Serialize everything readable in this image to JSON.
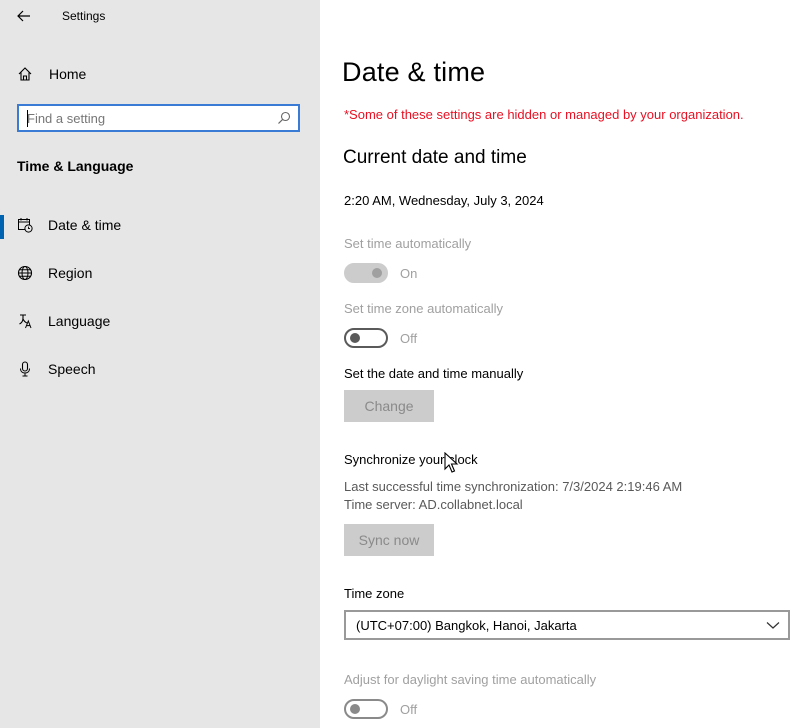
{
  "window": {
    "title": "Settings"
  },
  "nav": {
    "home_label": "Home",
    "search_placeholder": "Find a setting",
    "section_title": "Time & Language",
    "items": [
      {
        "label": "Date & time",
        "icon": "calendar-clock-icon",
        "selected": true
      },
      {
        "label": "Region",
        "icon": "globe-icon",
        "selected": false
      },
      {
        "label": "Language",
        "icon": "language-icon",
        "selected": false
      },
      {
        "label": "Speech",
        "icon": "microphone-icon",
        "selected": false
      }
    ]
  },
  "page": {
    "title": "Date & time",
    "org_note": "*Some of these settings are hidden or managed by your organization.",
    "current_heading": "Current date and time",
    "current_datetime": "2:20 AM, Wednesday, July 3, 2024",
    "set_time_auto": {
      "label": "Set time automatically",
      "state": "On",
      "enabled": false
    },
    "set_tz_auto": {
      "label": "Set time zone automatically",
      "state": "Off",
      "enabled": true
    },
    "manual": {
      "label": "Set the date and time manually",
      "button": "Change"
    },
    "sync": {
      "heading": "Synchronize your clock",
      "last_sync": "Last successful time synchronization: 7/3/2024 2:19:46 AM",
      "time_server": "Time server: AD.collabnet.local",
      "button": "Sync now"
    },
    "timezone": {
      "label": "Time zone",
      "value": "(UTC+07:00) Bangkok, Hanoi, Jakarta"
    },
    "dst": {
      "label": "Adjust for daylight saving time automatically",
      "state": "Off",
      "enabled": false
    }
  },
  "colors": {
    "accent": "#0063b1",
    "warning": "#e81123",
    "nav_background": "#e6e6e6"
  }
}
